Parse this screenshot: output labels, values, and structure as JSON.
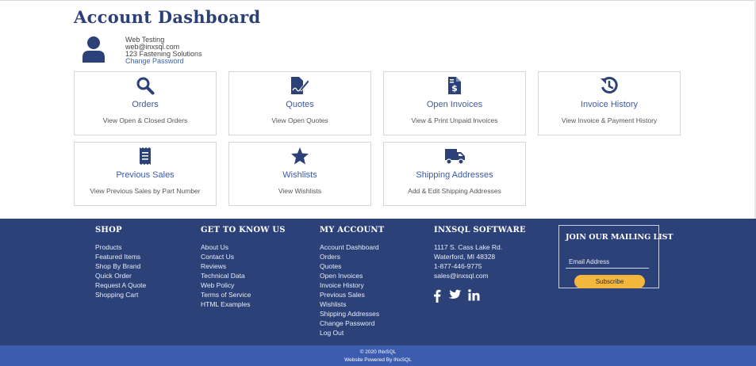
{
  "page": {
    "title": "Account Dashboard"
  },
  "user": {
    "name": "Web Testing",
    "email": "web@inxsql.com",
    "company": "123 Fastening Solutions",
    "change_password": "Change Password",
    "avatar_icon": "user-icon"
  },
  "tiles": [
    {
      "title": "Orders",
      "desc": "View Open & Closed Orders",
      "icon": "search-icon"
    },
    {
      "title": "Quotes",
      "desc": "View Open Quotes",
      "icon": "file-signature-icon"
    },
    {
      "title": "Open Invoices",
      "desc": "View & Print Unpaid Invoices",
      "icon": "file-invoice-dollar-icon"
    },
    {
      "title": "Invoice History",
      "desc": "View Invoice & Payment History",
      "icon": "history-icon"
    },
    {
      "title": "Previous Sales",
      "desc": "View Previous Sales by Part Number",
      "icon": "receipt-icon"
    },
    {
      "title": "Wishlists",
      "desc": "View Wishlists",
      "icon": "star-icon"
    },
    {
      "title": "Shipping Addresses",
      "desc": "Add & Edit Shipping Addresses",
      "icon": "truck-icon"
    }
  ],
  "footer": {
    "shop": {
      "heading": "SHOP",
      "links": [
        "Products",
        "Featured Items",
        "Shop By Brand",
        "Quick Order",
        "Request A Quote",
        "Shopping Cart"
      ]
    },
    "know": {
      "heading": "GET TO KNOW US",
      "links": [
        "About Us",
        "Contact Us",
        "Reviews",
        "Technical Data",
        "Web Policy",
        "Terms of Service",
        "HTML Examples"
      ]
    },
    "account": {
      "heading": "MY ACCOUNT",
      "links": [
        "Account Dashboard",
        "Orders",
        "Quotes",
        "Open Invoices",
        "Invoice History",
        "Previous Sales",
        "Wishlists",
        "Shipping Addresses",
        "Change Password",
        "Log Out"
      ]
    },
    "company": {
      "heading": "INXSQL SOFTWARE",
      "lines": [
        "1117 S. Cass Lake Rd.",
        "Waterford, MI 48328",
        "1-877-446-9775",
        "sales@inxsql.com"
      ],
      "social": [
        "facebook-icon",
        "twitter-icon",
        "linkedin-icon"
      ]
    },
    "mailing": {
      "heading": "JOIN OUR MAILING LIST",
      "placeholder": "Email Address",
      "button": "Subscribe"
    }
  },
  "bottom": {
    "copyright": "© 2020 INxSQL",
    "powered": "Website Powered By INxSQL"
  },
  "colors": {
    "brand_blue": "#2c4178",
    "link_blue": "#3c5aa8",
    "accent_yellow": "#f4b73d",
    "bottom_bar": "#3c5cb0"
  }
}
